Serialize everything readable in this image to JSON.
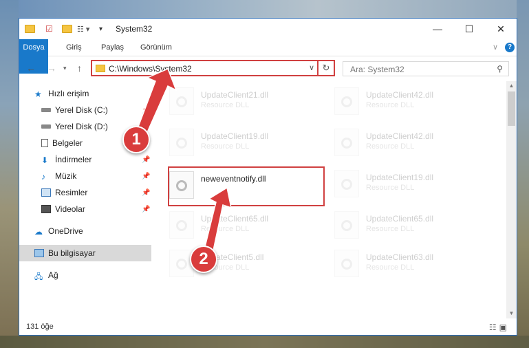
{
  "window": {
    "title": "System32"
  },
  "ribbon": {
    "tabs": [
      "Dosya",
      "Giriş",
      "Paylaş",
      "Görünüm"
    ]
  },
  "address": {
    "path": "C:\\Windows\\System32"
  },
  "search": {
    "placeholder": "Ara: System32"
  },
  "nav": {
    "items": [
      {
        "label": "Hızlı erişim",
        "icon": "star-icon"
      },
      {
        "label": "Yerel Disk (C:)",
        "icon": "drive-icon"
      },
      {
        "label": "Yerel Disk (D:)",
        "icon": "drive-icon"
      },
      {
        "label": "Belgeler",
        "icon": "documents-icon"
      },
      {
        "label": "İndirmeler",
        "icon": "download-icon"
      },
      {
        "label": "Müzik",
        "icon": "music-icon"
      },
      {
        "label": "Resimler",
        "icon": "pictures-icon"
      },
      {
        "label": "Videolar",
        "icon": "video-icon"
      },
      {
        "label": "OneDrive",
        "icon": "cloud-icon"
      },
      {
        "label": "Bu bilgisayar",
        "icon": "computer-icon"
      },
      {
        "label": "Ağ",
        "icon": "network-icon"
      }
    ]
  },
  "files": {
    "col1": [
      {
        "name": "UpdateClient21.dll",
        "desc": "Resource DLL"
      },
      {
        "name": "UpdateClient19.dll",
        "desc": "Resource DLL"
      },
      {
        "name": "neweventnotify.dll",
        "desc": ""
      },
      {
        "name": "UpdateClient65.dll",
        "desc": "Resource DLL"
      },
      {
        "name": "UpdateClient5.dll",
        "desc": "Resource DLL"
      }
    ],
    "col2": [
      {
        "name": "UpdateClient42.dll",
        "desc": "Resource DLL"
      },
      {
        "name": "UpdateClient42.dll",
        "desc": "Resource DLL"
      },
      {
        "name": "UpdateClient19.dll",
        "desc": "Resource DLL"
      },
      {
        "name": "UpdateClient65.dll",
        "desc": "Resource DLL"
      },
      {
        "name": "UpdateClient63.dll",
        "desc": "Resource DLL"
      }
    ]
  },
  "status": {
    "count": "131 öğe"
  },
  "annotations": {
    "step1": "1",
    "step2": "2",
    "color": "#d93c3c"
  }
}
